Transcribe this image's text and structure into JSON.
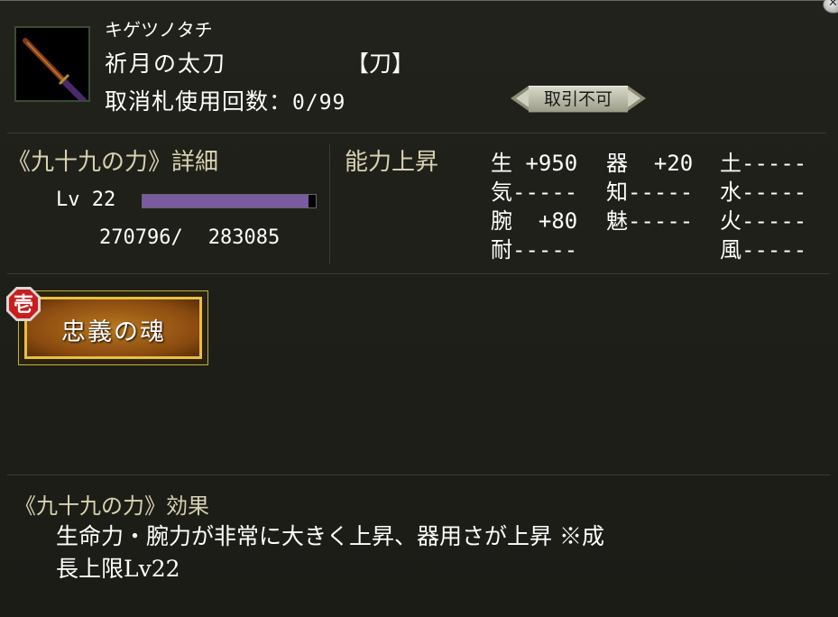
{
  "item": {
    "kana": "キゲツノタチ",
    "name": "祈月の太刀",
    "type": "【刀】",
    "usage_label": "取消札使用回数：",
    "usage_value": "0/99",
    "trade_badge": "取引不可"
  },
  "detail": {
    "title": "《九十九の力》詳細",
    "level_label": "Lv 22",
    "exp_current": "270796/",
    "exp_max": "283085",
    "exp_progress": 0.957
  },
  "ability": {
    "title": "能力上昇",
    "stats": [
      {
        "name": "生",
        "value": " +950"
      },
      {
        "name": "器",
        "value": "  +20"
      },
      {
        "name": "土",
        "value": "-----"
      },
      {
        "name": "気",
        "value": "-----"
      },
      {
        "name": "知",
        "value": "-----"
      },
      {
        "name": "水",
        "value": "-----"
      },
      {
        "name": "腕",
        "value": "  +80"
      },
      {
        "name": "魅",
        "value": "-----"
      },
      {
        "name": "火",
        "value": "-----"
      },
      {
        "name": "耐",
        "value": "-----"
      },
      {
        "name": "風",
        "value": "-----"
      }
    ]
  },
  "skill": {
    "badge": "壱",
    "label": "忠義の魂"
  },
  "effect": {
    "title": "《九十九の力》効果",
    "line1": "生命力・腕力が非常に大きく上昇、器用さが上昇 ※成",
    "line2": "長上限Lv22"
  },
  "colors": {
    "bar_fill": "#7a5aa0",
    "accent_gold": "#e8c040"
  }
}
